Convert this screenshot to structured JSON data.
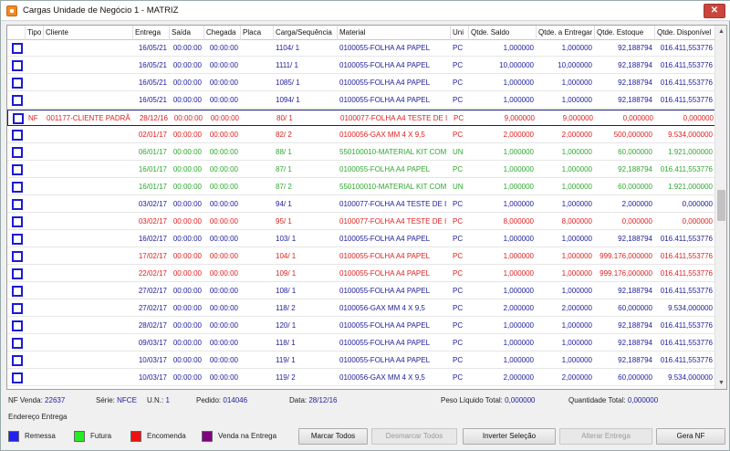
{
  "window": {
    "title": "Cargas Unidade de Negócio 1 - MATRIZ",
    "close_glyph": "✕"
  },
  "colors": {
    "blue": "#1c1c9c",
    "red": "#e02020",
    "green": "#2fa82f",
    "remessa": "#2222ee",
    "futura": "#22ee22",
    "encomenda": "#ee1111",
    "venda_na_entrega": "#800080"
  },
  "columns": [
    "Tipo",
    "Cliente",
    "Entrega",
    "Saída",
    "Chegada",
    "Placa",
    "Carga/Sequência",
    "Material",
    "Uni",
    "Qtde. Saldo",
    "Qtde. a Entregar",
    "Qtde. Estoque",
    "Qtde. Disponível"
  ],
  "rows": [
    {
      "color": "blue",
      "tipo": "",
      "cliente": "",
      "entrega": "16/05/21",
      "saida": "00:00:00",
      "chegada": "00:00:00",
      "placa": "",
      "carga": "1104/  1",
      "material": "0100055-FOLHA A4 PAPEL",
      "uni": "PC",
      "saldo": "1,000000",
      "entregar": "1,000000",
      "estoque": "92,188794",
      "disponivel": "016.411,553776"
    },
    {
      "color": "blue",
      "tipo": "",
      "cliente": "",
      "entrega": "16/05/21",
      "saida": "00:00:00",
      "chegada": "00:00:00",
      "placa": "",
      "carga": "1111/  1",
      "material": "0100055-FOLHA A4 PAPEL",
      "uni": "PC",
      "saldo": "10,000000",
      "entregar": "10,000000",
      "estoque": "92,188794",
      "disponivel": "016.411,553776"
    },
    {
      "color": "blue",
      "tipo": "",
      "cliente": "",
      "entrega": "16/05/21",
      "saida": "00:00:00",
      "chegada": "00:00:00",
      "placa": "",
      "carga": "1085/  1",
      "material": "0100055-FOLHA A4 PAPEL",
      "uni": "PC",
      "saldo": "1,000000",
      "entregar": "1,000000",
      "estoque": "92,188794",
      "disponivel": "016.411,553776"
    },
    {
      "color": "blue",
      "tipo": "",
      "cliente": "",
      "entrega": "16/05/21",
      "saida": "00:00:00",
      "chegada": "00:00:00",
      "placa": "",
      "carga": "1094/  1",
      "material": "0100055-FOLHA A4 PAPEL",
      "uni": "PC",
      "saldo": "1,000000",
      "entregar": "1,000000",
      "estoque": "92,188794",
      "disponivel": "016.411,553776"
    },
    {
      "color": "red",
      "tipo": "NF",
      "cliente": "001177-CLIENTE PADRÃ",
      "entrega": "28/12/16",
      "saida": "00:00:00",
      "chegada": "00:00:00",
      "placa": "",
      "carga": "80/  1",
      "material": "0100077-FOLHA A4 TESTE DE I",
      "uni": "PC",
      "saldo": "9,000000",
      "entregar": "9,000000",
      "estoque": "0,000000",
      "disponivel": "0,000000",
      "selected": true
    },
    {
      "color": "red",
      "tipo": "",
      "cliente": "",
      "entrega": "02/01/17",
      "saida": "00:00:00",
      "chegada": "00:00:00",
      "placa": "",
      "carga": "82/  2",
      "material": "0100056-GAX MM 4 X 9,5",
      "uni": "PC",
      "saldo": "2,000000",
      "entregar": "2,000000",
      "estoque": "500,000000",
      "disponivel": "9.534,000000"
    },
    {
      "color": "green",
      "tipo": "",
      "cliente": "",
      "entrega": "06/01/17",
      "saida": "00:00:00",
      "chegada": "00:00:00",
      "placa": "",
      "carga": "88/  1",
      "material": "550100010-MATERIAL KIT COM",
      "uni": "UN",
      "saldo": "1,000000",
      "entregar": "1,000000",
      "estoque": "60,000000",
      "disponivel": "1.921,000000"
    },
    {
      "color": "green",
      "tipo": "",
      "cliente": "",
      "entrega": "16/01/17",
      "saida": "00:00:00",
      "chegada": "00:00:00",
      "placa": "",
      "carga": "87/  1",
      "material": "0100055-FOLHA A4 PAPEL",
      "uni": "PC",
      "saldo": "1,000000",
      "entregar": "1,000000",
      "estoque": "92,188794",
      "disponivel": "016.411,553776"
    },
    {
      "color": "green",
      "tipo": "",
      "cliente": "",
      "entrega": "16/01/17",
      "saida": "00:00:00",
      "chegada": "00:00:00",
      "placa": "",
      "carga": "87/  2",
      "material": "550100010-MATERIAL KIT COM",
      "uni": "UN",
      "saldo": "1,000000",
      "entregar": "1,000000",
      "estoque": "60,000000",
      "disponivel": "1.921,000000"
    },
    {
      "color": "blue",
      "tipo": "",
      "cliente": "",
      "entrega": "03/02/17",
      "saida": "00:00:00",
      "chegada": "00:00:00",
      "placa": "",
      "carga": "94/  1",
      "material": "0100077-FOLHA A4 TESTE DE I",
      "uni": "PC",
      "saldo": "1,000000",
      "entregar": "1,000000",
      "estoque": "2,000000",
      "disponivel": "0,000000"
    },
    {
      "color": "red",
      "tipo": "",
      "cliente": "",
      "entrega": "03/02/17",
      "saida": "00:00:00",
      "chegada": "00:00:00",
      "placa": "",
      "carga": "95/  1",
      "material": "0100077-FOLHA A4 TESTE DE I",
      "uni": "PC",
      "saldo": "8,000000",
      "entregar": "8,000000",
      "estoque": "0,000000",
      "disponivel": "0,000000"
    },
    {
      "color": "blue",
      "tipo": "",
      "cliente": "",
      "entrega": "16/02/17",
      "saida": "00:00:00",
      "chegada": "00:00:00",
      "placa": "",
      "carga": "103/  1",
      "material": "0100055-FOLHA A4 PAPEL",
      "uni": "PC",
      "saldo": "1,000000",
      "entregar": "1,000000",
      "estoque": "92,188794",
      "disponivel": "016.411,553776"
    },
    {
      "color": "red",
      "tipo": "",
      "cliente": "",
      "entrega": "17/02/17",
      "saida": "00:00:00",
      "chegada": "00:00:00",
      "placa": "",
      "carga": "104/  1",
      "material": "0100055-FOLHA A4 PAPEL",
      "uni": "PC",
      "saldo": "1,000000",
      "entregar": "1,000000",
      "estoque": "999.176,000000",
      "disponivel": "016.411,553776"
    },
    {
      "color": "red",
      "tipo": "",
      "cliente": "",
      "entrega": "22/02/17",
      "saida": "00:00:00",
      "chegada": "00:00:00",
      "placa": "",
      "carga": "109/  1",
      "material": "0100055-FOLHA A4 PAPEL",
      "uni": "PC",
      "saldo": "1,000000",
      "entregar": "1,000000",
      "estoque": "999.176,000000",
      "disponivel": "016.411,553776"
    },
    {
      "color": "blue",
      "tipo": "",
      "cliente": "",
      "entrega": "27/02/17",
      "saida": "00:00:00",
      "chegada": "00:00:00",
      "placa": "",
      "carga": "108/  1",
      "material": "0100055-FOLHA A4 PAPEL",
      "uni": "PC",
      "saldo": "1,000000",
      "entregar": "1,000000",
      "estoque": "92,188794",
      "disponivel": "016.411,553776"
    },
    {
      "color": "blue",
      "tipo": "",
      "cliente": "",
      "entrega": "27/02/17",
      "saida": "00:00:00",
      "chegada": "00:00:00",
      "placa": "",
      "carga": "118/  2",
      "material": "0100056-GAX MM 4 X 9,5",
      "uni": "PC",
      "saldo": "2,000000",
      "entregar": "2,000000",
      "estoque": "60,000000",
      "disponivel": "9.534,000000"
    },
    {
      "color": "blue",
      "tipo": "",
      "cliente": "",
      "entrega": "28/02/17",
      "saida": "00:00:00",
      "chegada": "00:00:00",
      "placa": "",
      "carga": "120/  1",
      "material": "0100055-FOLHA A4 PAPEL",
      "uni": "PC",
      "saldo": "1,000000",
      "entregar": "1,000000",
      "estoque": "92,188794",
      "disponivel": "016.411,553776"
    },
    {
      "color": "blue",
      "tipo": "",
      "cliente": "",
      "entrega": "09/03/17",
      "saida": "00:00:00",
      "chegada": "00:00:00",
      "placa": "",
      "carga": "118/  1",
      "material": "0100055-FOLHA A4 PAPEL",
      "uni": "PC",
      "saldo": "1,000000",
      "entregar": "1,000000",
      "estoque": "92,188794",
      "disponivel": "016.411,553776"
    },
    {
      "color": "blue",
      "tipo": "",
      "cliente": "",
      "entrega": "10/03/17",
      "saida": "00:00:00",
      "chegada": "00:00:00",
      "placa": "",
      "carga": "119/  1",
      "material": "0100055-FOLHA A4 PAPEL",
      "uni": "PC",
      "saldo": "1,000000",
      "entregar": "1,000000",
      "estoque": "92,188794",
      "disponivel": "016.411,553776"
    },
    {
      "color": "blue",
      "tipo": "",
      "cliente": "",
      "entrega": "10/03/17",
      "saida": "00:00:00",
      "chegada": "00:00:00",
      "placa": "",
      "carga": "119/  2",
      "material": "0100056-GAX MM 4 X 9,5",
      "uni": "PC",
      "saldo": "2,000000",
      "entregar": "2,000000",
      "estoque": "60,000000",
      "disponivel": "9.534,000000"
    }
  ],
  "scroll": {
    "up": "▲",
    "down": "▼"
  },
  "status": {
    "nf_venda_label": "NF Venda:",
    "nf_venda": "22637",
    "serie_label": "Série:",
    "serie": "NFCE",
    "un_label": "U.N.:",
    "un": "1",
    "pedido_label": "Pedido:",
    "pedido": "014046",
    "data_label": "Data:",
    "data": "28/12/16",
    "peso_label": "Peso Líquido Total:",
    "peso": "0,000000",
    "qtd_label": "Quantidade Total:",
    "qtd": "0,000000"
  },
  "endereco_label": "Endereço Entrega",
  "legend": {
    "remessa": "Remessa",
    "futura": "Futura",
    "encomenda": "Encomenda",
    "venda_na_entrega": "Venda na Entrega"
  },
  "buttons": {
    "marcar_todos": "Marcar Todos",
    "desmarcar_todos": "Desmarcar Todos",
    "inverter_selecao": "Inverter Seleção",
    "alterar_entrega": "Alterar Entrega",
    "gera_nf": "Gera NF"
  }
}
